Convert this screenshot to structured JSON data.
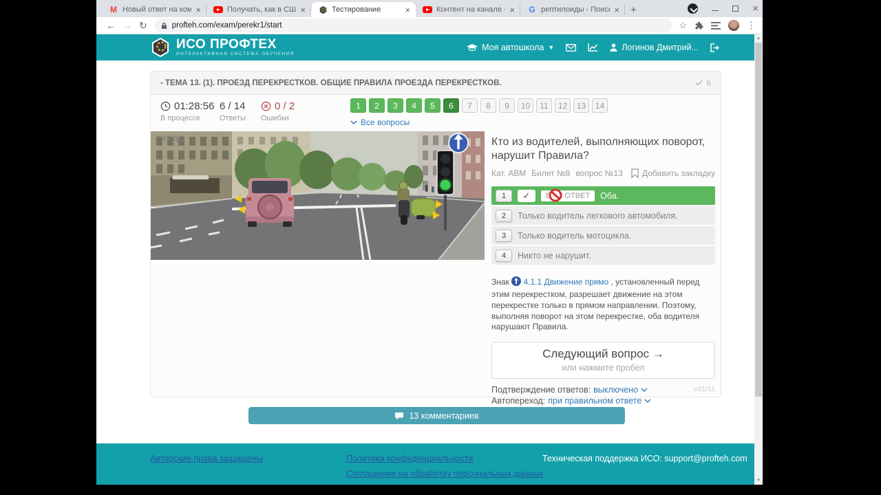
{
  "browser": {
    "tabs": [
      {
        "title": "Новый ответ на коммент",
        "icon": "gmail-icon"
      },
      {
        "title": "Получать, как в США, тра",
        "icon": "youtube-icon"
      },
      {
        "title": "Тестирование",
        "icon": "profteh-icon"
      },
      {
        "title": "Контент на канале - YouT",
        "icon": "youtube-icon"
      },
      {
        "title": "рептилоиды - Поиск в G",
        "icon": "google-icon"
      }
    ],
    "url": "profteh.com/exam/perekr1/start"
  },
  "header": {
    "logo_title": "ИСО ПРОФТЕХ",
    "logo_subtitle": "ИНТЕРАКТИВНАЯ СИСТЕМА ОБУЧЕНИЯ",
    "nav_school": "Моя автошкола",
    "user_name": "Логинов Дмитрий..."
  },
  "exam": {
    "topic_title": "- ТЕМА 13. (1). ПРОЕЗД ПЕРЕКРЕСТКОВ. ОБЩИЕ ПРАВИЛА ПРОЕЗДА ПЕРЕКРЕСТКОВ.",
    "topic_check_count": "6",
    "timer": {
      "value": "01:28:56",
      "label": "В процессе"
    },
    "answers_stat": {
      "value": "6 / 14",
      "label": "Ответы"
    },
    "errors_stat": {
      "value": "0 / 2",
      "label": "Ошибки"
    },
    "question_buttons": [
      {
        "label": "1",
        "state": "answered"
      },
      {
        "label": "2",
        "state": "answered"
      },
      {
        "label": "3",
        "state": "answered"
      },
      {
        "label": "4",
        "state": "answered"
      },
      {
        "label": "5",
        "state": "answered"
      },
      {
        "label": "6",
        "state": "current"
      },
      {
        "label": "7",
        "state": "pending"
      },
      {
        "label": "8",
        "state": "pending"
      },
      {
        "label": "9",
        "state": "pending"
      },
      {
        "label": "10",
        "state": "pending"
      },
      {
        "label": "11",
        "state": "pending"
      },
      {
        "label": "12",
        "state": "pending"
      },
      {
        "label": "13",
        "state": "pending"
      },
      {
        "label": "14",
        "state": "pending"
      }
    ],
    "all_questions_label": "Все вопросы",
    "question": {
      "text": "Кто из водителей, выполняющих поворот, нарушит Правила?",
      "meta_cat": "Кат. АВМ",
      "meta_ticket": "Билет №8",
      "meta_number": "вопрос №13",
      "bookmark_label": "Добавить закладку",
      "answers": [
        {
          "num": "1",
          "badge": "ВАШ ОТВЕТ",
          "text": "Оба."
        },
        {
          "num": "2",
          "text": "Только водитель легкового автомобиля."
        },
        {
          "num": "3",
          "text": "Только водитель мотоцикла."
        },
        {
          "num": "4",
          "text": "Никто не нарушит."
        }
      ],
      "explanation_prefix": "Знак",
      "explanation_link": "4.1.1 Движение прямо",
      "explanation_rest": " , установленный перед этим перекрестком, разрешает движение на этом перекрестке только в прямом направлении. Поэтому, выполняя поворот на этом перекрестке, оба водителя нарушают Правила."
    },
    "next_button": {
      "label": "Следующий вопрос →",
      "hint": "или нажмите пробел"
    },
    "settings": {
      "confirm_label": "Подтверждение ответов:",
      "confirm_value": "выключено",
      "auto_label": "Автопереход:",
      "auto_value": "при правильном ответе",
      "version": "v01/11"
    }
  },
  "scene": {
    "watermark": "ГИБДД"
  },
  "comments": {
    "label": "13 комментариев"
  },
  "footer": {
    "copyright_link": "Авторские права защищены",
    "privacy_link": "Политика конфиденциальности",
    "agreement_link": "Соглашение на обработку персональных данных",
    "support_label": "Техническая поддержка ИСО:",
    "support_email": "support@profteh.com"
  },
  "colors": {
    "teal": "#14a0aa",
    "green": "#5cb85c",
    "green_active": "#3d8b3d",
    "link_blue": "#337ab7",
    "error_red": "#a94442",
    "comments_teal": "#4ba2b4"
  }
}
